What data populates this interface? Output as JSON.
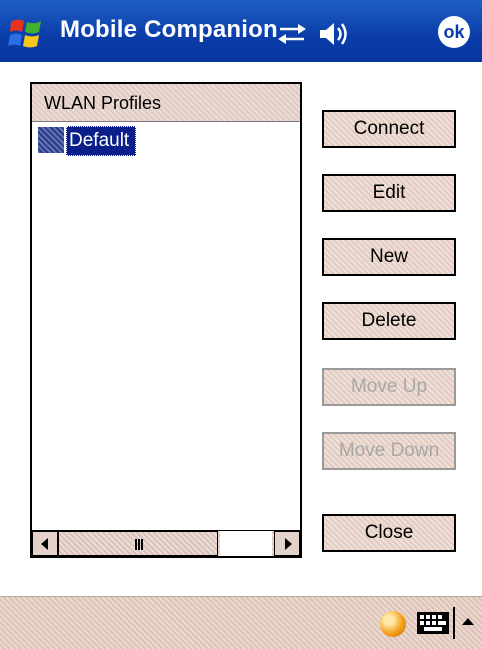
{
  "titlebar": {
    "app_title": "Mobile Companion",
    "ok_label": "ok",
    "start_icon": "windows-flag-icon",
    "connectivity_icon": "connectivity-arrows-icon",
    "volume_icon": "speaker-icon"
  },
  "list": {
    "header": "WLAN Profiles",
    "items": [
      {
        "label": "Default",
        "icon": "wlan-profile-icon",
        "selected": true
      }
    ]
  },
  "buttons": {
    "connect": "Connect",
    "edit": "Edit",
    "new": "New",
    "delete": "Delete",
    "move_up": "Move Up",
    "move_down": "Move Down",
    "close": "Close"
  },
  "menubar": {
    "status_icon": "status-orb-icon",
    "keyboard_icon": "keyboard-icon",
    "sip_icon": "input-panel-arrow-icon"
  },
  "colors": {
    "titlebar": "#0a3ca8",
    "selection": "#0a1f8a",
    "button_face": "#e8d5cc",
    "disabled_text": "#a8a8a8"
  }
}
